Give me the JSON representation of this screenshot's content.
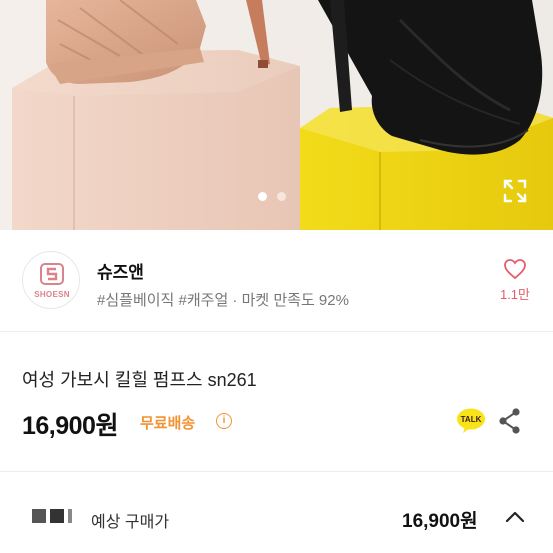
{
  "hero": {
    "image_alt": "",
    "pagination_total": 2,
    "pagination_active": 1
  },
  "seller": {
    "logo_text": "SHOESN",
    "name": "슈즈앤",
    "tags": "#심플베이직 #캐주얼 · 마켓 만족도 92%",
    "like_count": "1.1만"
  },
  "product": {
    "title": "여성 가보시 킬힐 펌프스 sn261",
    "price": "16,900원",
    "shipping": "무료배송",
    "info_symbol": "i",
    "talk_label": "TALK"
  },
  "expected": {
    "label": "예상 구매가",
    "price": "16,900원"
  },
  "colors": {
    "accent_orange": "#f19332",
    "like_pink": "#e35d6a",
    "logo_pink": "#d9848a",
    "talk_yellow": "#f7e317"
  }
}
